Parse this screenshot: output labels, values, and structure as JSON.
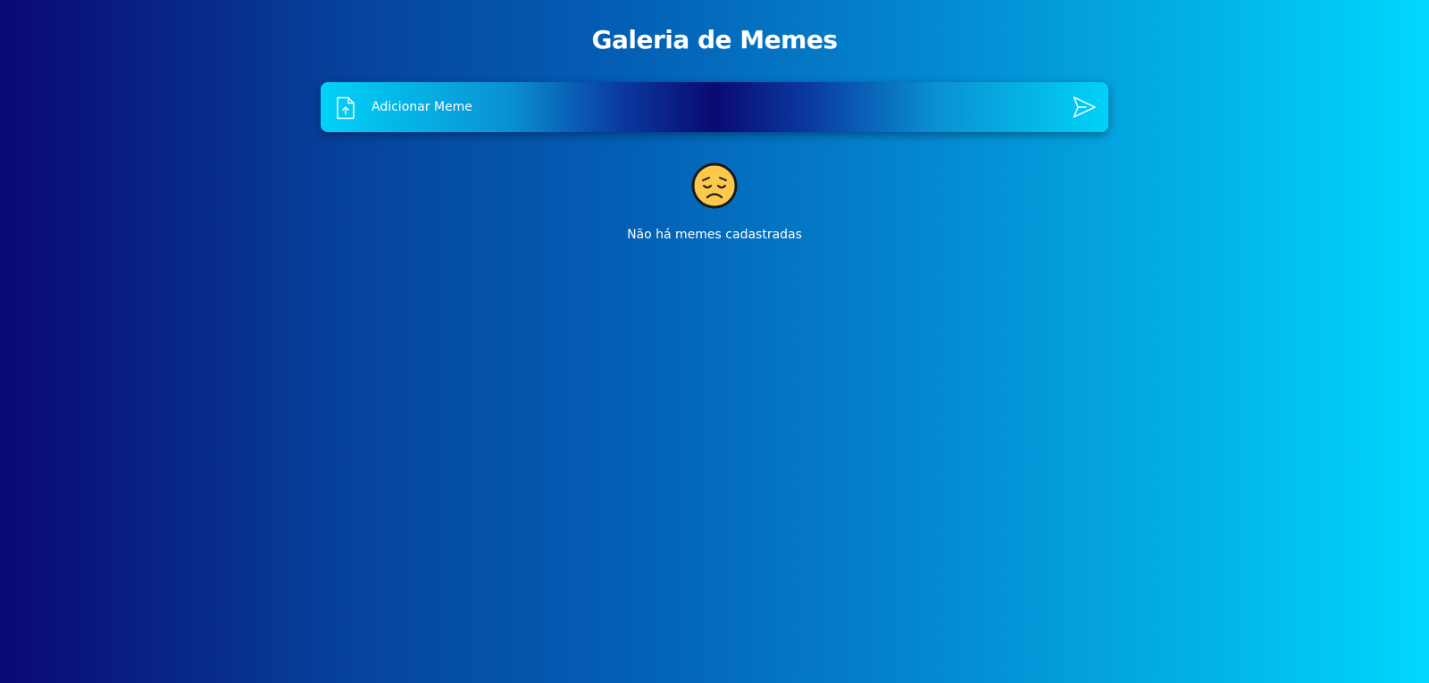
{
  "header": {
    "title": "Galeria de Memes"
  },
  "upload": {
    "label": "Adicionar Meme",
    "icon": "file-upload-icon",
    "submit_icon": "send-icon"
  },
  "empty_state": {
    "icon": "sad-face-icon",
    "message": "Não há memes cadastradas"
  },
  "colors": {
    "background_start": "#0a0874",
    "background_end": "#00d7ff",
    "bar_edge": "#00d2f8",
    "bar_center": "#0a0a72",
    "face_fill": "#fcc94d",
    "text": "#ffffff"
  }
}
